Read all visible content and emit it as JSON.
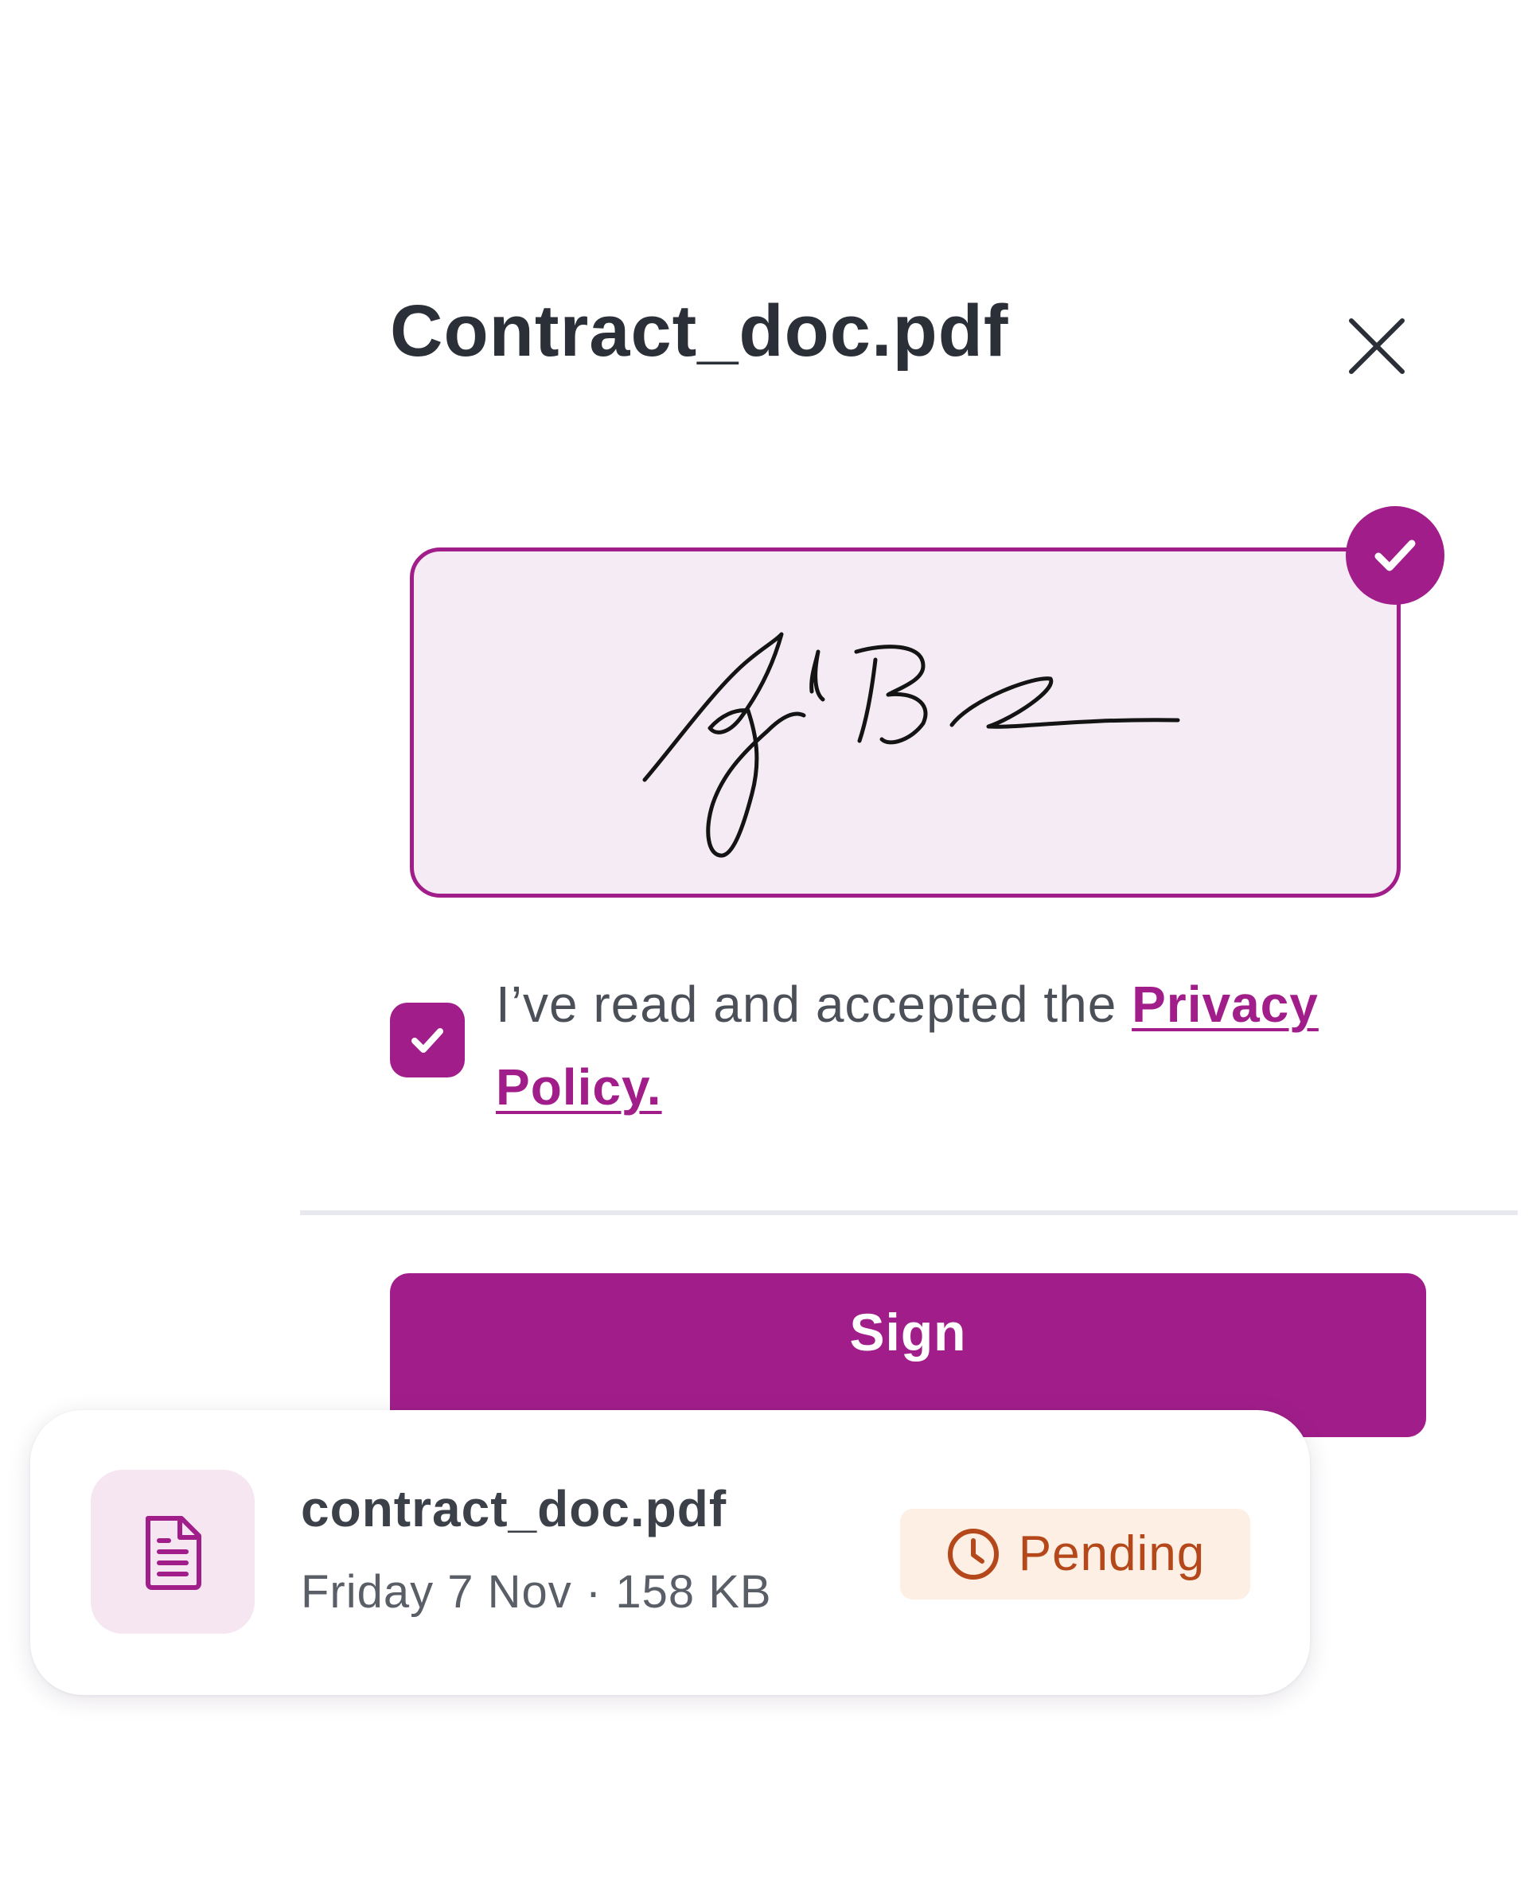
{
  "dialog": {
    "title": "Contract_doc.pdf",
    "close_icon": "close-icon"
  },
  "signature": {
    "selected": true,
    "check_icon": "checkmark-icon"
  },
  "consent": {
    "checked": true,
    "text": "I’ve read and accepted the ",
    "link_label": "Privacy Policy."
  },
  "actions": {
    "sign_label": "Sign"
  },
  "file_card": {
    "icon": "document-icon",
    "file_name": "contract_doc.pdf",
    "meta": "Friday 7 Nov · 158 KB",
    "status_icon": "clock-icon",
    "status_label": "Pending"
  },
  "colors": {
    "accent": "#a11e8a",
    "signature_bg": "#f5ebf4",
    "pending_text": "#b5481a",
    "pending_bg": "#fdefe4"
  }
}
